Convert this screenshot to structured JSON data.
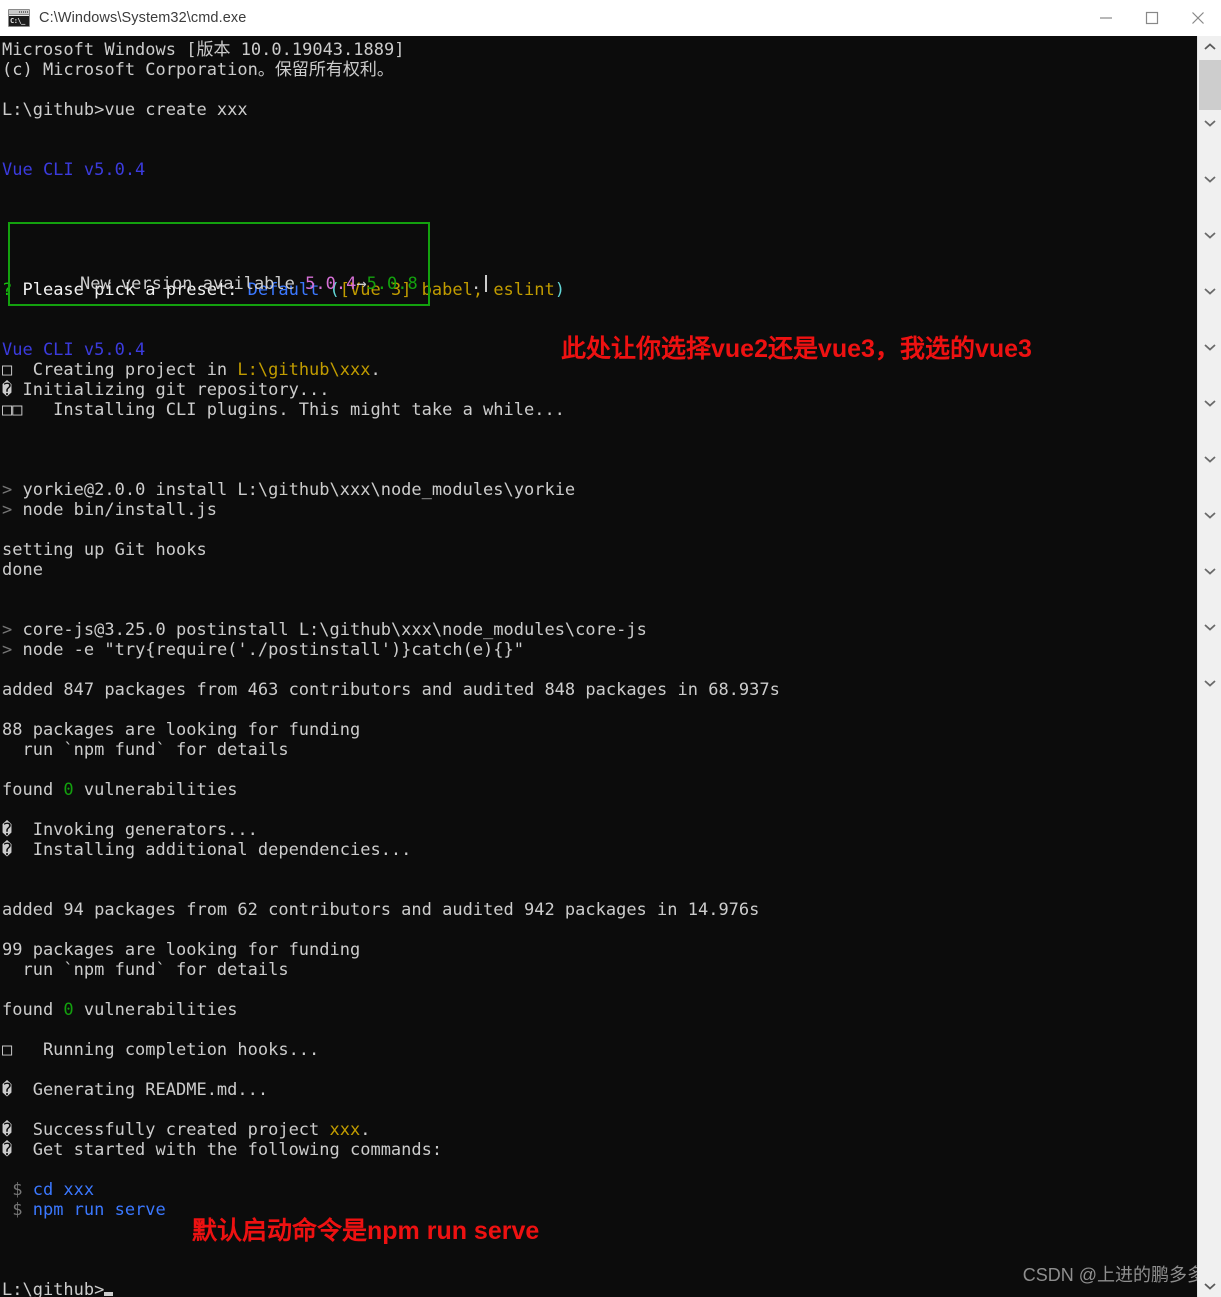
{
  "window": {
    "title": "C:\\Windows\\System32\\cmd.exe",
    "icon": "cmd-icon",
    "icon_glyph": "C:\\_",
    "buttons": {
      "minimize": "minimize-button",
      "maximize": "maximize-button",
      "close": "close-button"
    }
  },
  "colors": {
    "background": "#0c0c0c",
    "foreground": "#cccccc",
    "blue": "#3b3bdd",
    "bright_blue": "#3b78ff",
    "cyan": "#61d6d6",
    "green": "#13a10e",
    "yellow": "#c19c00",
    "magenta": "#b4009e",
    "gray": "#767676",
    "annotation_red": "#ee1111"
  },
  "console": {
    "lines": [
      {
        "id": "ms-version",
        "segs": [
          {
            "t": "Microsoft Windows [版本 10.0.19043.1889]",
            "c": "c-white"
          }
        ]
      },
      {
        "id": "ms-copyright",
        "segs": [
          {
            "t": "(c) Microsoft Corporation。保留所有权利。",
            "c": "c-white"
          }
        ]
      },
      {
        "id": "blank-1",
        "segs": [
          {
            "t": " ",
            "c": "c-white"
          }
        ]
      },
      {
        "id": "prompt-vue-create",
        "segs": [
          {
            "t": "L:\\github>vue create xxx",
            "c": "c-white"
          }
        ]
      },
      {
        "id": "blank-2",
        "segs": [
          {
            "t": " ",
            "c": "c-white"
          }
        ]
      },
      {
        "id": "blank-3",
        "segs": [
          {
            "t": " ",
            "c": "c-white"
          }
        ]
      },
      {
        "id": "vue-cli-banner-1",
        "segs": [
          {
            "t": "Vue CLI v5.0.4",
            "c": "c-blue"
          }
        ]
      },
      {
        "id": "box-top",
        "segs": [
          {
            "t": " ",
            "c": "c-white"
          }
        ]
      },
      {
        "id": "box-mid-1",
        "segs": [
          {
            "t": " ",
            "c": "c-white"
          }
        ]
      },
      {
        "id": "box-mid-2",
        "segs": [
          {
            "t": " ",
            "c": "c-white"
          }
        ]
      },
      {
        "id": "box-bot",
        "segs": [
          {
            "t": " ",
            "c": "c-white"
          }
        ]
      },
      {
        "id": "blank-4",
        "segs": [
          {
            "t": " ",
            "c": "c-white"
          }
        ]
      },
      {
        "id": "preset-question",
        "segs": [
          {
            "t": "? ",
            "c": "c-green"
          },
          {
            "t": "Please pick a preset: ",
            "c": "c-bwhite"
          },
          {
            "t": "Default ",
            "c": "c-bblue"
          },
          {
            "t": "(",
            "c": "c-cyan"
          },
          {
            "t": "[Vue 3] babel, eslint",
            "c": "c-yellow"
          },
          {
            "t": ")",
            "c": "c-cyan"
          }
        ]
      },
      {
        "id": "blank-5",
        "segs": [
          {
            "t": " ",
            "c": "c-white"
          }
        ]
      },
      {
        "id": "blank-6",
        "segs": [
          {
            "t": " ",
            "c": "c-white"
          }
        ]
      },
      {
        "id": "vue-cli-banner-2",
        "segs": [
          {
            "t": "Vue CLI v5.0.4",
            "c": "c-blue"
          }
        ]
      },
      {
        "id": "creating-project",
        "segs": [
          {
            "t": "□  Creating project in ",
            "c": "c-white"
          },
          {
            "t": "L:\\github\\xxx",
            "c": "c-yellow"
          },
          {
            "t": ".",
            "c": "c-white"
          }
        ]
      },
      {
        "id": "init-git",
        "segs": [
          {
            "t": "� Initializing git repository...",
            "c": "c-white"
          }
        ]
      },
      {
        "id": "installing-plugins",
        "segs": [
          {
            "t": "□□   Installing CLI plugins. This might take a while...",
            "c": "c-white"
          }
        ]
      },
      {
        "id": "blank-7",
        "segs": [
          {
            "t": " ",
            "c": "c-white"
          }
        ]
      },
      {
        "id": "blank-8",
        "segs": [
          {
            "t": " ",
            "c": "c-white"
          }
        ]
      },
      {
        "id": "blank-9",
        "segs": [
          {
            "t": " ",
            "c": "c-white"
          }
        ]
      },
      {
        "id": "yorkie-install",
        "segs": [
          {
            "t": "> ",
            "c": "c-gray"
          },
          {
            "t": "yorkie@2.0.0 install L:\\github\\xxx\\node_modules\\yorkie",
            "c": "c-white"
          }
        ]
      },
      {
        "id": "yorkie-node",
        "segs": [
          {
            "t": "> ",
            "c": "c-gray"
          },
          {
            "t": "node bin/install.js",
            "c": "c-white"
          }
        ]
      },
      {
        "id": "blank-10",
        "segs": [
          {
            "t": " ",
            "c": "c-white"
          }
        ]
      },
      {
        "id": "setting-git-hooks",
        "segs": [
          {
            "t": "setting up Git hooks",
            "c": "c-white"
          }
        ]
      },
      {
        "id": "done",
        "segs": [
          {
            "t": "done",
            "c": "c-white"
          }
        ]
      },
      {
        "id": "blank-11",
        "segs": [
          {
            "t": " ",
            "c": "c-white"
          }
        ]
      },
      {
        "id": "blank-12",
        "segs": [
          {
            "t": " ",
            "c": "c-white"
          }
        ]
      },
      {
        "id": "corejs-postinstall",
        "segs": [
          {
            "t": "> ",
            "c": "c-gray"
          },
          {
            "t": "core-js@3.25.0 postinstall L:\\github\\xxx\\node_modules\\core-js",
            "c": "c-white"
          }
        ]
      },
      {
        "id": "corejs-node",
        "segs": [
          {
            "t": "> ",
            "c": "c-gray"
          },
          {
            "t": "node -e \"try{require('./postinstall')}catch(e){}\"",
            "c": "c-white"
          }
        ]
      },
      {
        "id": "blank-13",
        "segs": [
          {
            "t": " ",
            "c": "c-white"
          }
        ]
      },
      {
        "id": "added-847",
        "segs": [
          {
            "t": "added 847 packages from 463 contributors and audited 848 packages in 68.937s",
            "c": "c-white"
          }
        ]
      },
      {
        "id": "blank-14",
        "segs": [
          {
            "t": " ",
            "c": "c-white"
          }
        ]
      },
      {
        "id": "funding-88",
        "segs": [
          {
            "t": "88 packages are looking for funding",
            "c": "c-white"
          }
        ]
      },
      {
        "id": "run-npm-fund-1",
        "segs": [
          {
            "t": "  run `npm fund` for details",
            "c": "c-white"
          }
        ]
      },
      {
        "id": "blank-15",
        "segs": [
          {
            "t": " ",
            "c": "c-white"
          }
        ]
      },
      {
        "id": "vulns-1",
        "segs": [
          {
            "t": "found ",
            "c": "c-white"
          },
          {
            "t": "0",
            "c": "c-dgreen"
          },
          {
            "t": " vulnerabilities",
            "c": "c-white"
          }
        ]
      },
      {
        "id": "blank-16",
        "segs": [
          {
            "t": " ",
            "c": "c-white"
          }
        ]
      },
      {
        "id": "invoking-generators",
        "segs": [
          {
            "t": "�  Invoking generators...",
            "c": "c-white"
          }
        ]
      },
      {
        "id": "installing-additional",
        "segs": [
          {
            "t": "�  Installing additional dependencies...",
            "c": "c-white"
          }
        ]
      },
      {
        "id": "blank-17",
        "segs": [
          {
            "t": " ",
            "c": "c-white"
          }
        ]
      },
      {
        "id": "blank-18",
        "segs": [
          {
            "t": " ",
            "c": "c-white"
          }
        ]
      },
      {
        "id": "added-94",
        "segs": [
          {
            "t": "added 94 packages from 62 contributors and audited 942 packages in 14.976s",
            "c": "c-white"
          }
        ]
      },
      {
        "id": "blank-19",
        "segs": [
          {
            "t": " ",
            "c": "c-white"
          }
        ]
      },
      {
        "id": "funding-99",
        "segs": [
          {
            "t": "99 packages are looking for funding",
            "c": "c-white"
          }
        ]
      },
      {
        "id": "run-npm-fund-2",
        "segs": [
          {
            "t": "  run `npm fund` for details",
            "c": "c-white"
          }
        ]
      },
      {
        "id": "blank-20",
        "segs": [
          {
            "t": " ",
            "c": "c-white"
          }
        ]
      },
      {
        "id": "vulns-2",
        "segs": [
          {
            "t": "found ",
            "c": "c-white"
          },
          {
            "t": "0",
            "c": "c-dgreen"
          },
          {
            "t": " vulnerabilities",
            "c": "c-white"
          }
        ]
      },
      {
        "id": "blank-21",
        "segs": [
          {
            "t": " ",
            "c": "c-white"
          }
        ]
      },
      {
        "id": "running-hooks",
        "segs": [
          {
            "t": "□   Running completion hooks...",
            "c": "c-white"
          }
        ]
      },
      {
        "id": "blank-22",
        "segs": [
          {
            "t": " ",
            "c": "c-white"
          }
        ]
      },
      {
        "id": "generating-readme",
        "segs": [
          {
            "t": "�  Generating README.md...",
            "c": "c-white"
          }
        ]
      },
      {
        "id": "blank-23",
        "segs": [
          {
            "t": " ",
            "c": "c-white"
          }
        ]
      },
      {
        "id": "success-created",
        "segs": [
          {
            "t": "�  Successfully created project ",
            "c": "c-white"
          },
          {
            "t": "xxx",
            "c": "c-yellow"
          },
          {
            "t": ".",
            "c": "c-white"
          }
        ]
      },
      {
        "id": "get-started",
        "segs": [
          {
            "t": "�  Get started with the following commands:",
            "c": "c-white"
          }
        ]
      },
      {
        "id": "blank-24",
        "segs": [
          {
            "t": " ",
            "c": "c-white"
          }
        ]
      },
      {
        "id": "cmd-cd",
        "segs": [
          {
            "t": " $ ",
            "c": "c-gray"
          },
          {
            "t": "cd xxx",
            "c": "c-bblue"
          }
        ]
      },
      {
        "id": "cmd-serve",
        "segs": [
          {
            "t": " $ ",
            "c": "c-gray"
          },
          {
            "t": "npm run serve",
            "c": "c-bblue"
          }
        ]
      },
      {
        "id": "blank-25",
        "segs": [
          {
            "t": " ",
            "c": "c-white"
          }
        ]
      },
      {
        "id": "blank-26",
        "segs": [
          {
            "t": " ",
            "c": "c-white"
          }
        ]
      },
      {
        "id": "blank-27",
        "segs": [
          {
            "t": " ",
            "c": "c-white"
          }
        ]
      },
      {
        "id": "final-prompt",
        "segs": [
          {
            "t": "L:\\github>",
            "c": "c-white"
          }
        ],
        "caret": "block"
      }
    ]
  },
  "notice": {
    "label": "New version available ",
    "current_version": "5.0.4",
    "arrow": "→",
    "new_version": "5.0.8",
    "trailing_dot": "."
  },
  "annotations": [
    {
      "id": "annot-preset",
      "text": "此处让你选择vue2还是vue3，我选的vue3"
    },
    {
      "id": "annot-serve",
      "text": "默认启动命令是npm run serve"
    }
  ],
  "watermark": {
    "text": "CSDN @上进的鹏多多"
  },
  "scrollbar": {
    "up_arrow": "chevron-up-icon",
    "down_arrow": "chevron-down-icon",
    "track_marks": 11
  }
}
